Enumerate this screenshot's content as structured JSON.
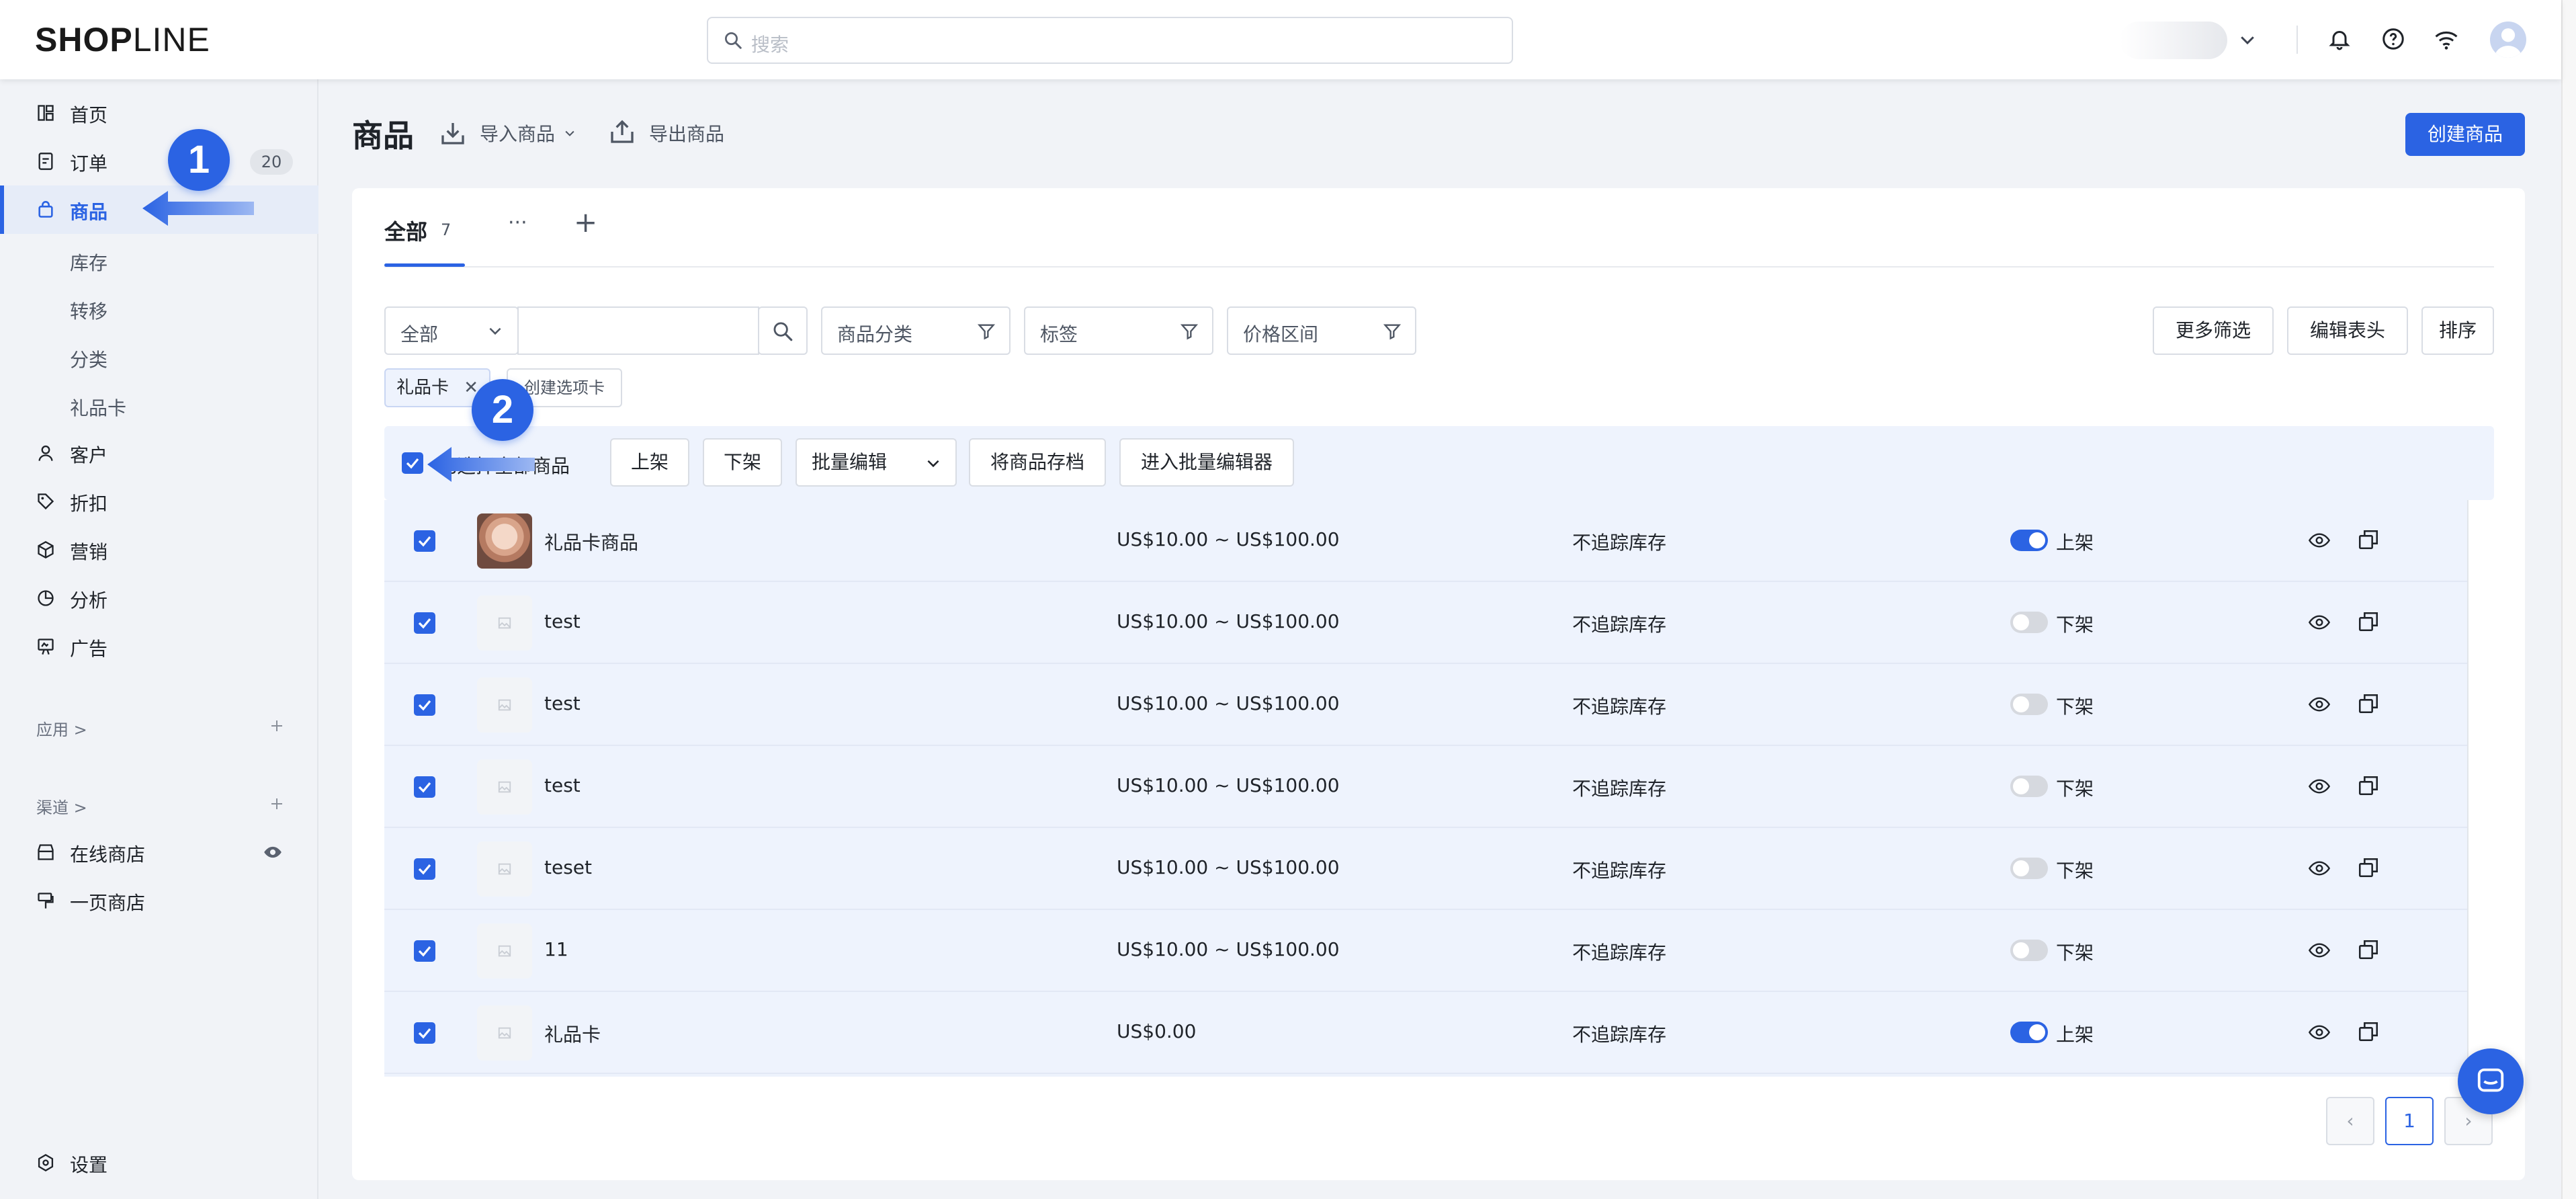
{
  "app": {
    "logo_bold": "SHOP",
    "logo_light": "LINE"
  },
  "search": {
    "placeholder": "搜索"
  },
  "topbar_icons": [
    "chevron-down-icon",
    "bell-icon",
    "help-icon",
    "wifi-icon",
    "avatar"
  ],
  "sidebar": {
    "items": [
      {
        "label": "首页",
        "icon": "dashboard-icon"
      },
      {
        "label": "订单",
        "icon": "order-icon",
        "badge": "20"
      },
      {
        "label": "商品",
        "icon": "bag-icon",
        "active": true
      },
      {
        "label": "客户",
        "icon": "user-icon"
      },
      {
        "label": "折扣",
        "icon": "tag-icon"
      },
      {
        "label": "营销",
        "icon": "cube-icon"
      },
      {
        "label": "分析",
        "icon": "pie-icon"
      },
      {
        "label": "广告",
        "icon": "ad-icon"
      }
    ],
    "subitems": [
      "库存",
      "转移",
      "分类",
      "礼品卡"
    ],
    "apps_label": "应用 >",
    "channels_label": "渠道 >",
    "channels": [
      {
        "label": "在线商店",
        "icon": "store-icon"
      },
      {
        "label": "一页商店",
        "icon": "page-store-icon"
      }
    ],
    "settings_label": "设置"
  },
  "markers": {
    "one": "1",
    "two": "2"
  },
  "header": {
    "title": "商品",
    "import_label": "导入商品",
    "export_label": "导出商品",
    "create_label": "创建商品"
  },
  "tabs": {
    "active_label": "全部",
    "active_count": "7",
    "more": "···",
    "add": "+"
  },
  "filters": {
    "scope_value": "全部",
    "category": "商品分类",
    "tag": "标签",
    "price": "价格区间",
    "more": "更多筛选",
    "edit_columns": "编辑表头",
    "sort": "排序"
  },
  "chips": {
    "applied": "礼品卡",
    "create_tab": "创建选项卡"
  },
  "bulk": {
    "selected_label": "已选择全部商品",
    "publish": "上架",
    "unpublish": "下架",
    "batch_edit": "批量编辑",
    "archive": "将商品存档",
    "enter_editor": "进入批量编辑器"
  },
  "rows": [
    {
      "name": "礼品卡商品",
      "price": "US$10.00 ~ US$100.00",
      "stock": "不追踪库存",
      "status": "上架",
      "on": true,
      "thumb": "cat"
    },
    {
      "name": "test",
      "price": "US$10.00 ~ US$100.00",
      "stock": "不追踪库存",
      "status": "下架",
      "on": false,
      "thumb": "placeholder"
    },
    {
      "name": "test",
      "price": "US$10.00 ~ US$100.00",
      "stock": "不追踪库存",
      "status": "下架",
      "on": false,
      "thumb": "placeholder"
    },
    {
      "name": "test",
      "price": "US$10.00 ~ US$100.00",
      "stock": "不追踪库存",
      "status": "下架",
      "on": false,
      "thumb": "placeholder"
    },
    {
      "name": "teset",
      "price": "US$10.00 ~ US$100.00",
      "stock": "不追踪库存",
      "status": "下架",
      "on": false,
      "thumb": "placeholder"
    },
    {
      "name": "11",
      "price": "US$10.00 ~ US$100.00",
      "stock": "不追踪库存",
      "status": "下架",
      "on": false,
      "thumb": "placeholder"
    },
    {
      "name": "礼品卡",
      "price": "US$0.00",
      "stock": "不追踪库存",
      "status": "上架",
      "on": true,
      "thumb": "placeholder"
    }
  ],
  "pagination": {
    "prev": "‹",
    "current": "1",
    "next": "›"
  },
  "colors": {
    "accent": "#2b63e3",
    "sidebar_bg": "#f1f3f7",
    "row_bg": "#eef3fd"
  }
}
